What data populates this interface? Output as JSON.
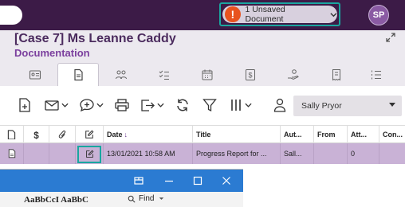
{
  "topbar": {
    "unsaved_label": "1 Unsaved Document",
    "warn_symbol": "!",
    "avatar_initials": "SP",
    "accent_color": "#3c1b47",
    "highlight_color": "#1aa6a0"
  },
  "case": {
    "title": "[Case 7] Ms Leanne Caddy",
    "subtitle": "Documentation"
  },
  "tabs": [
    {
      "icon": "id-card-icon"
    },
    {
      "icon": "document-icon",
      "active": true
    },
    {
      "icon": "people-icon"
    },
    {
      "icon": "checklist-icon"
    },
    {
      "icon": "calendar-icon"
    },
    {
      "icon": "dollar-icon"
    },
    {
      "icon": "hand-money-icon"
    },
    {
      "icon": "receipt-icon"
    },
    {
      "icon": "numbered-list-icon"
    }
  ],
  "toolbar": {
    "selected_user": "Sally Pryor"
  },
  "table": {
    "headers": [
      "Date",
      "Title",
      "Aut...",
      "From",
      "Att...",
      "Con..."
    ],
    "sort_indicator": "↓",
    "row": {
      "date": "13/01/2021 10:58 AM",
      "title": "Progress Report for ...",
      "author": "Sall...",
      "from": "",
      "attachments": "0",
      "contact": ""
    }
  },
  "window": {
    "find_label": "Find",
    "doc_text": "AaBbCcI  AaBbC"
  }
}
